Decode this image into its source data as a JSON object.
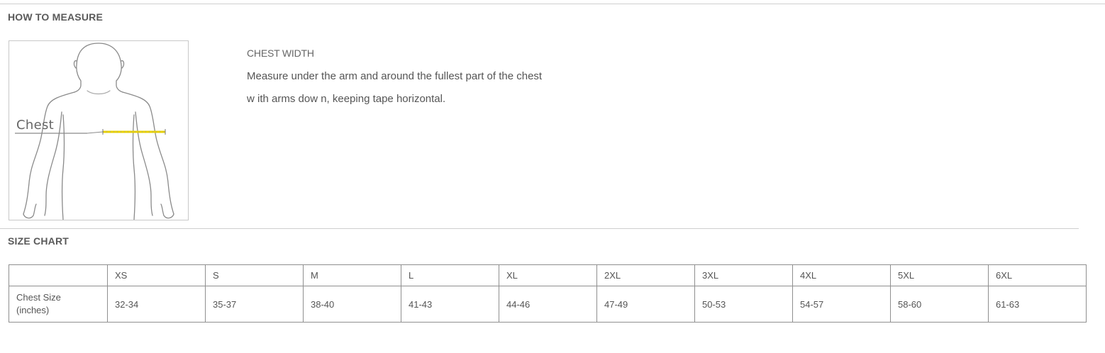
{
  "how_to_measure": {
    "title": "HOW TO MEASURE",
    "figure_label": "Chest",
    "measure_title": "CHEST WIDTH",
    "instructions": [
      "Measure under the arm and around the fullest part of the chest",
      "w ith arms dow n, keeping tape horizontal."
    ]
  },
  "size_chart": {
    "title": "SIZE CHART",
    "sizes": [
      "XS",
      "S",
      "M",
      "L",
      "XL",
      "2XL",
      "3XL",
      "4XL",
      "5XL",
      "6XL"
    ],
    "row_label_line1": "Chest Size",
    "row_label_line2": "(inches)",
    "chest_inches": [
      "32-34",
      "35-37",
      "38-40",
      "41-43",
      "44-46",
      "47-49",
      "50-53",
      "54-57",
      "58-60",
      "61-63"
    ]
  },
  "colors": {
    "tape": "#e8d000",
    "rule": "#cfcfcf",
    "table_border": "#8f8f8f"
  }
}
